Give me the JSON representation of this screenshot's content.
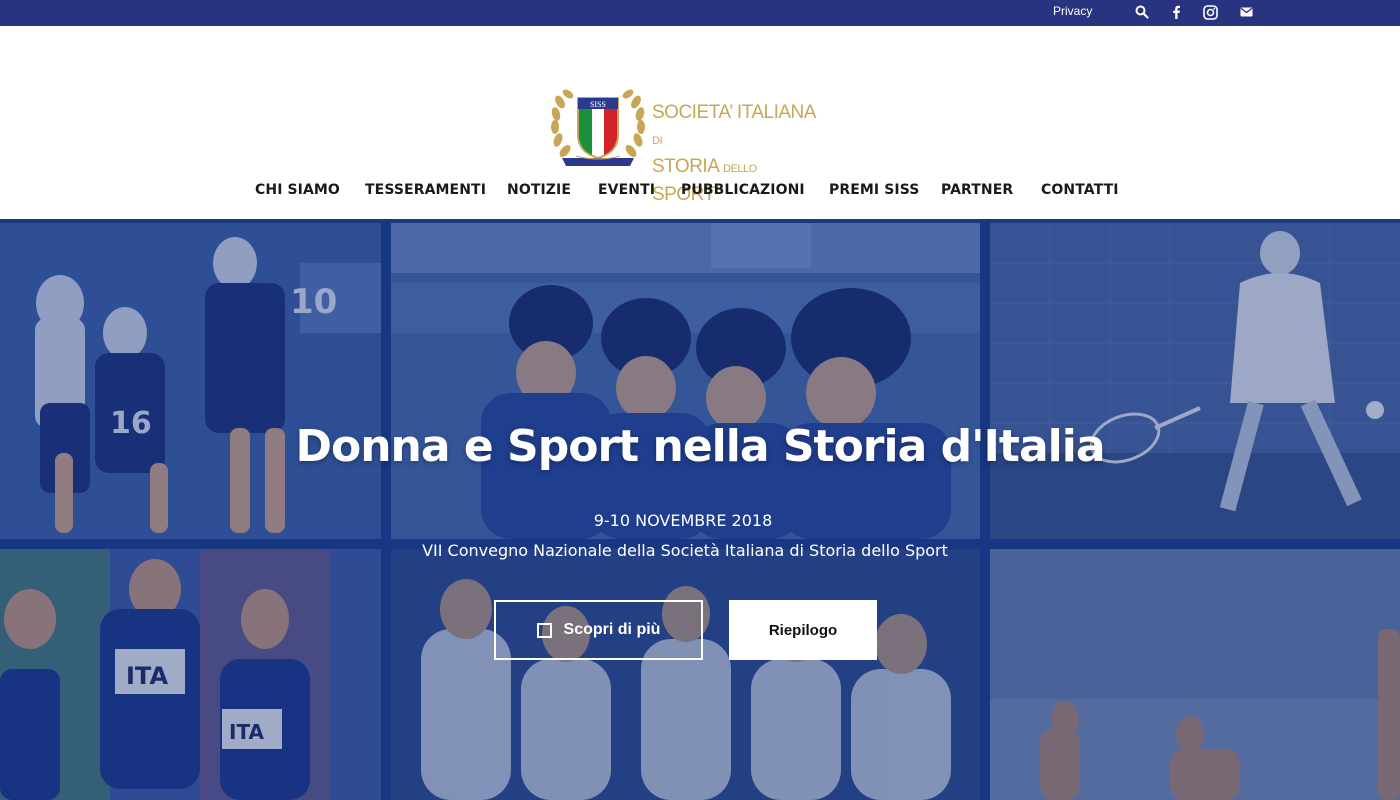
{
  "topbar": {
    "privacy_label": "Privacy",
    "icons": [
      "search-icon",
      "facebook-icon",
      "instagram-icon",
      "mail-icon"
    ],
    "background": "#28347f"
  },
  "logo": {
    "badge_text": "SISS",
    "line1_a": "SOCIETA’ ITALIANA",
    "line1_b": "DI",
    "line2_a": "STORIA",
    "line2_b": "DELLO",
    "line2_c": "SPORT",
    "color": "#c8a655"
  },
  "nav": {
    "items": [
      {
        "label": "CHI SIAMO"
      },
      {
        "label": "TESSERAMENTI"
      },
      {
        "label": "NOTIZIE"
      },
      {
        "label": "EVENTI"
      },
      {
        "label": "PUBBLICAZIONI"
      },
      {
        "label": "PREMI SISS"
      },
      {
        "label": "PARTNER"
      },
      {
        "label": "CONTATTI"
      }
    ]
  },
  "hero": {
    "title": "Donna e Sport nella Storia d'Italia",
    "date": "9-10 NOVEMBRE 2018",
    "subtitle": "VII Convegno Nazionale della Società Italiana di Storia dello Sport",
    "button_more": "Scopri di più",
    "button_summary": "Riepilogo"
  }
}
